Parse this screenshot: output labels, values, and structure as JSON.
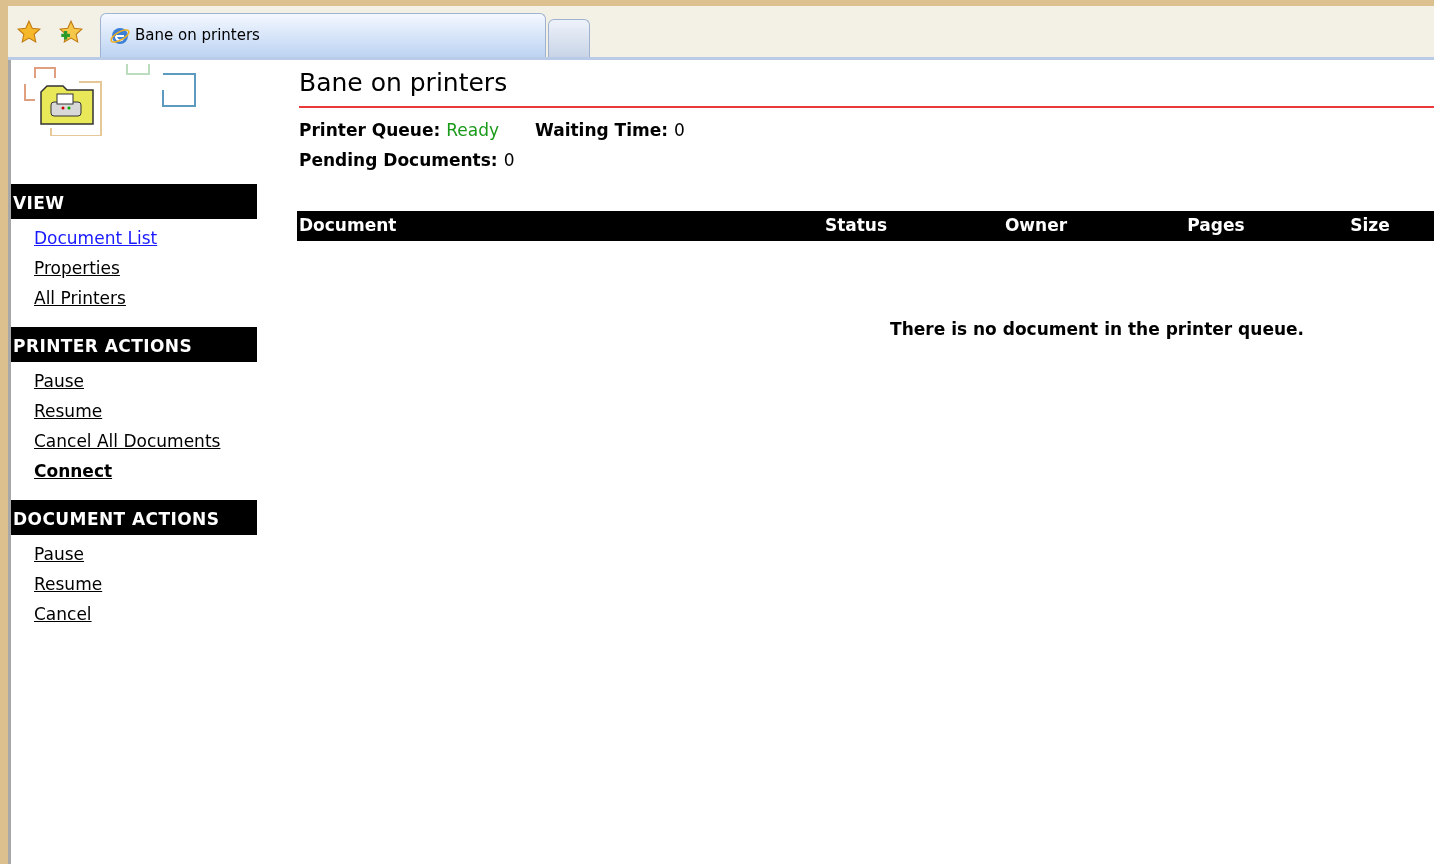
{
  "browser": {
    "tabs": [
      {
        "title": "Bane on printers",
        "selected": true
      },
      {
        "selected": false
      }
    ]
  },
  "sidebar": {
    "sections": [
      {
        "title": "VIEW",
        "links": [
          {
            "label": "Document List",
            "selected": true,
            "bold": false
          },
          {
            "label": "Properties",
            "selected": false,
            "bold": false
          },
          {
            "label": "All Printers",
            "selected": false,
            "bold": false
          }
        ]
      },
      {
        "title": "PRINTER ACTIONS",
        "links": [
          {
            "label": "Pause",
            "selected": false,
            "bold": false
          },
          {
            "label": "Resume",
            "selected": false,
            "bold": false
          },
          {
            "label": "Cancel All Documents",
            "selected": false,
            "bold": false
          },
          {
            "label": "Connect",
            "selected": false,
            "bold": true
          }
        ]
      },
      {
        "title": "DOCUMENT ACTIONS",
        "links": [
          {
            "label": "Pause",
            "selected": false,
            "bold": false
          },
          {
            "label": "Resume",
            "selected": false,
            "bold": false
          },
          {
            "label": "Cancel",
            "selected": false,
            "bold": false
          }
        ]
      }
    ]
  },
  "page": {
    "title": "Bane on printers",
    "status": [
      {
        "label": "Printer Queue:",
        "value": "Ready",
        "color": "#1a9a1a"
      },
      {
        "label": "Waiting Time:",
        "value": "0",
        "color": "#000000"
      },
      {
        "label": "Pending Documents:",
        "value": "0",
        "color": "#000000"
      }
    ],
    "table": {
      "columns": [
        "Document",
        "Status",
        "Owner",
        "Pages",
        "Size"
      ],
      "empty_message": "There is no document in the printer queue."
    }
  }
}
